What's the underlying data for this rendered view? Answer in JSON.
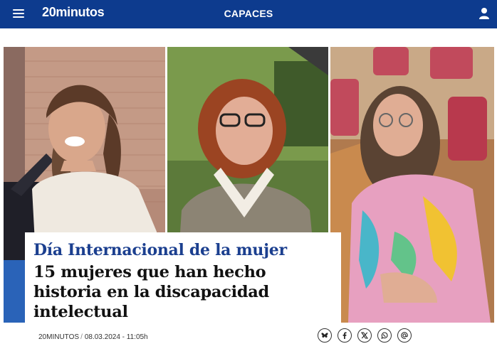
{
  "header": {
    "logo": "20minutos",
    "section": "CAPACES"
  },
  "article": {
    "kicker": "Día Internacional de la mujer",
    "title": "15 mujeres que han hecho historia en la discapacidad intelectual",
    "author": "20MINUTOS",
    "separator": "/",
    "date": "08.03.2024 - 11:05h"
  },
  "share": [
    "bluesky-icon",
    "facebook-icon",
    "x-icon",
    "whatsapp-icon",
    "email-icon"
  ],
  "colors": {
    "header_bg": "#0d3b8e",
    "kicker": "#1b3f8f",
    "title": "#111111"
  }
}
